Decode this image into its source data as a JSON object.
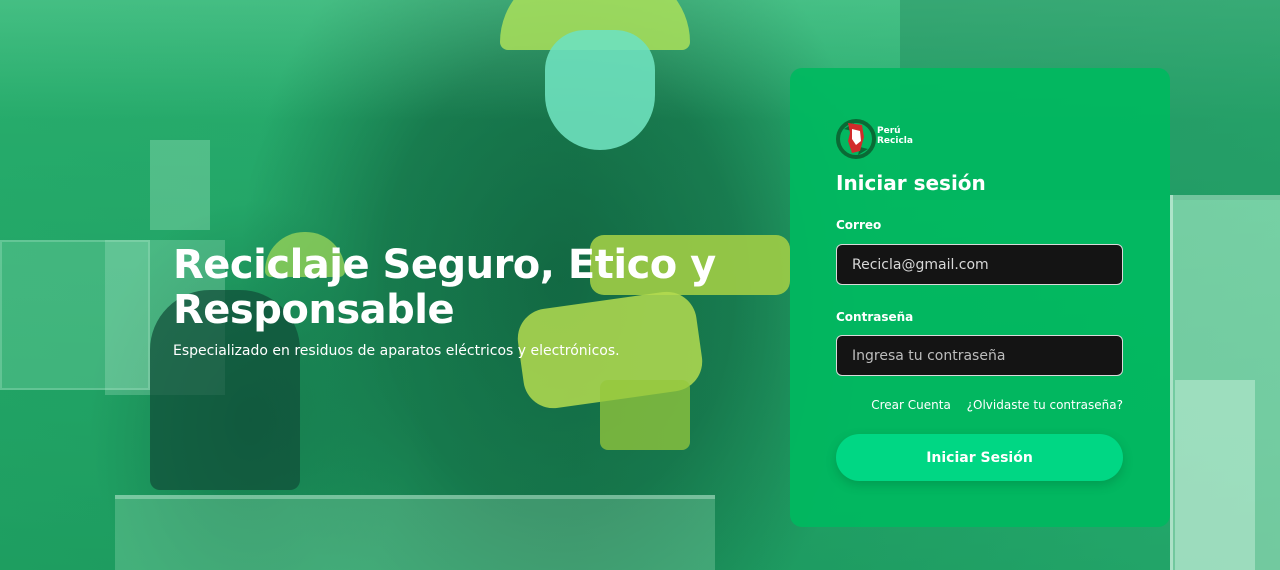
{
  "hero": {
    "title": "Reciclaje Seguro, Etico y Responsable",
    "subtitle": "Especializado en residuos de aparatos eléctricos y electrónicos."
  },
  "logo": {
    "line1": "Perú",
    "line2": "Recicla"
  },
  "login": {
    "title": "Iniciar sesión",
    "email_label": "Correo",
    "email_value": "Recicla@gmail.com",
    "password_label": "Contraseña",
    "password_placeholder": "Ingresa tu contraseña",
    "create_account": "Crear Cuenta",
    "forgot_password": "¿Olvidaste tu contraseña?",
    "submit": "Iniciar Sesión"
  },
  "colors": {
    "card": "#00b95f",
    "button": "#00d784",
    "input_bg": "#141414"
  }
}
